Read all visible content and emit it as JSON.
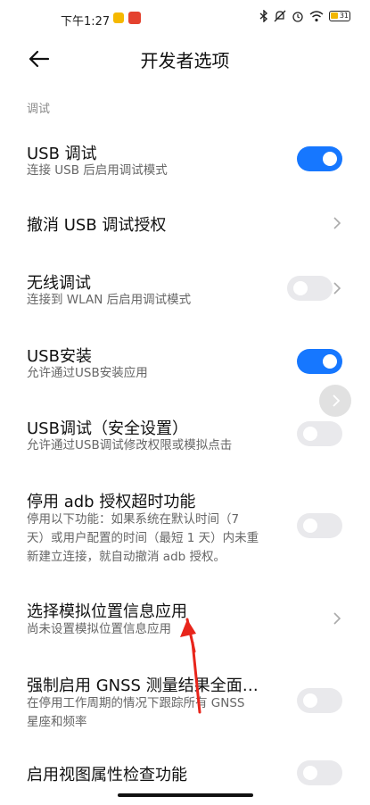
{
  "status_bar": {
    "time": "下午1:27",
    "battery": "31",
    "icons": [
      "bluetooth-icon",
      "mute-icon",
      "alarm-icon",
      "wifi-icon",
      "battery-icon"
    ]
  },
  "header": {
    "title": "开发者选项"
  },
  "section": {
    "label": "调试"
  },
  "settings": [
    {
      "title": "USB 调试",
      "subtitle": "连接 USB 后启用调试模式",
      "control": "toggle",
      "state": "on"
    },
    {
      "title": "撤消 USB 调试授权",
      "control": "chevron"
    },
    {
      "title": "无线调试",
      "subtitle": "连接到 WLAN 后启用调试模式",
      "control": "toggle",
      "state": "off"
    },
    {
      "title": "USB安装",
      "subtitle": "允许通过USB安装应用",
      "control": "toggle",
      "state": "on"
    },
    {
      "title": "USB调试（安全设置）",
      "subtitle": "允许通过USB调试修改权限或模拟点击",
      "control": "toggle",
      "state": "off"
    },
    {
      "title": "停用 adb 授权超时功能",
      "subtitle_lines": [
        "停用以下功能：如果系统在默认时间（7",
        "天）或用户配置的时间（最短 1 天）内未重",
        "新建立连接，就自动撤消 adb 授权。"
      ],
      "control": "toggle",
      "state": "off"
    },
    {
      "title": "选择模拟位置信息应用",
      "subtitle": "尚未设置模拟位置信息应用",
      "control": "chevron"
    },
    {
      "title": "强制启用 GNSS 测量结果全面…",
      "subtitle_lines": [
        "在停用工作周期的情况下跟踪所有 GNSS",
        "星座和频率"
      ],
      "control": "toggle",
      "state": "off"
    },
    {
      "title": "启用视图属性检查功能",
      "control": "toggle",
      "state": "off"
    }
  ],
  "colors": {
    "accent": "#1677ff",
    "toggle_off": "#e9e9ec",
    "annotation_arrow": "#e8251b"
  }
}
